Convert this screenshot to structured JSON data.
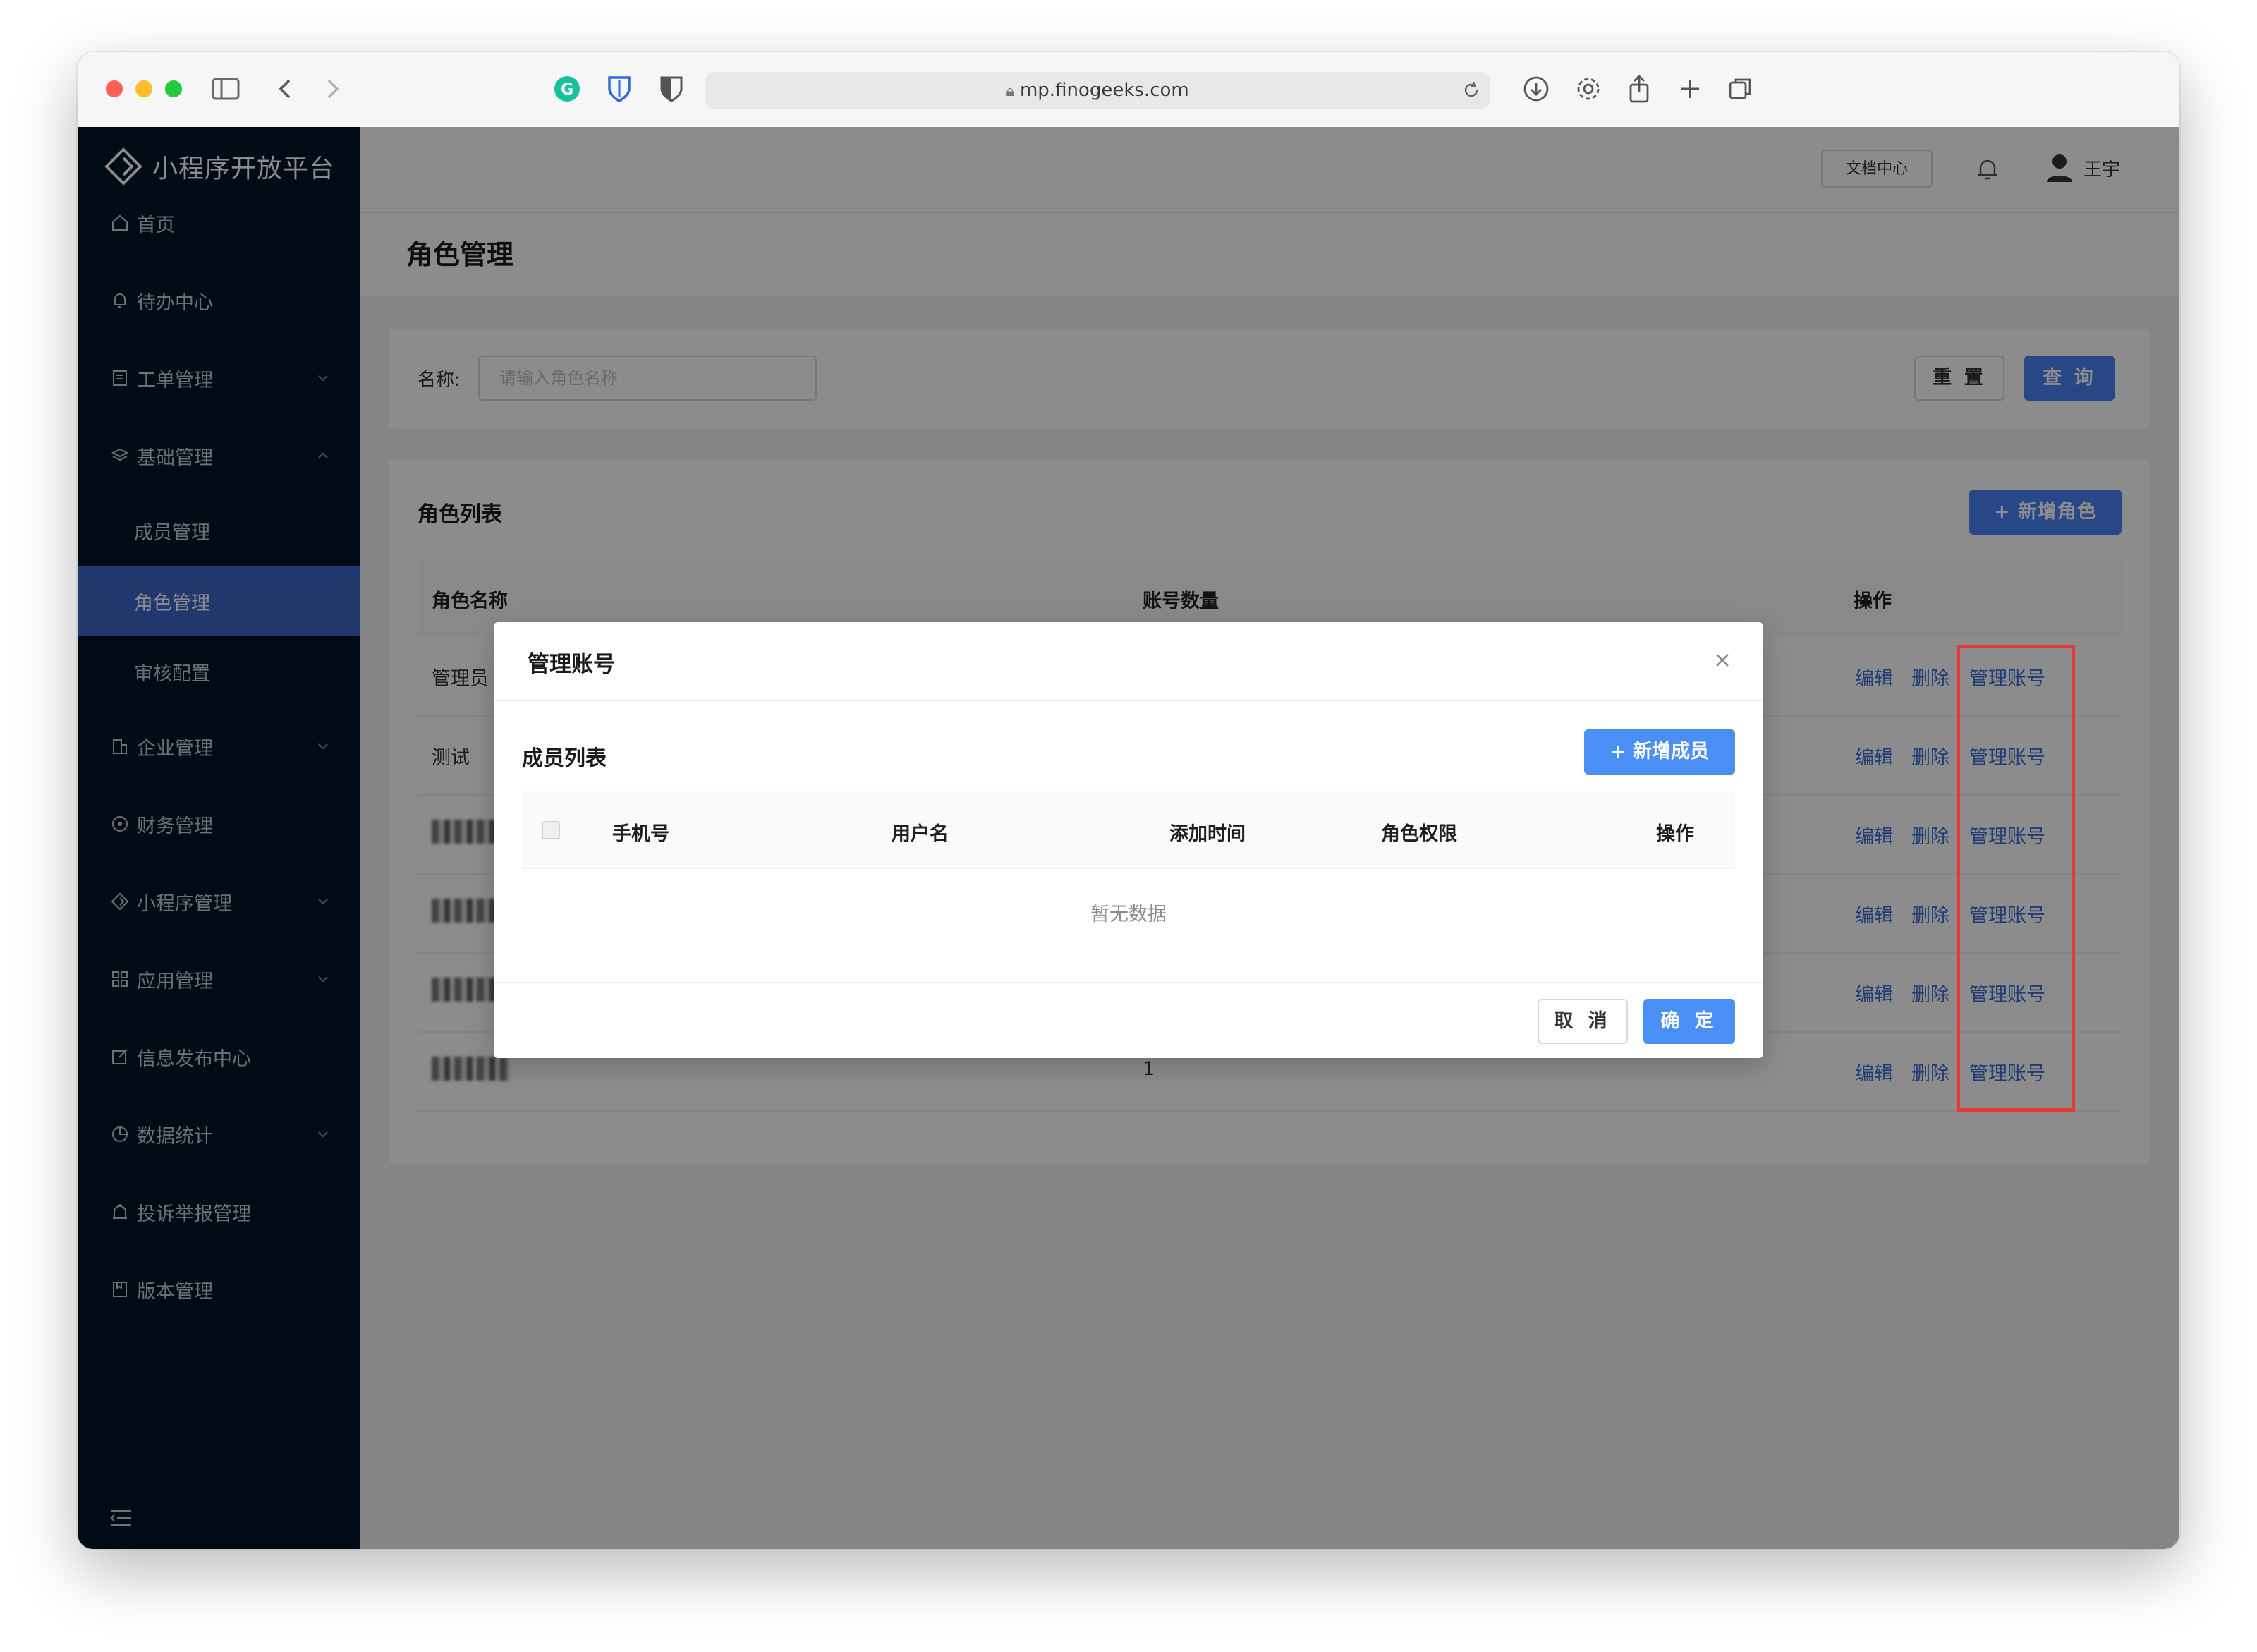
{
  "browser": {
    "url": "mp.finogeeks.com"
  },
  "sidebar": {
    "brand": "小程序开放平台",
    "items": [
      {
        "label": "首页",
        "icon": "home-icon",
        "has_arrow": false
      },
      {
        "label": "待办中心",
        "icon": "bell-icon",
        "has_arrow": false
      },
      {
        "label": "工单管理",
        "icon": "document-icon",
        "has_arrow": true
      },
      {
        "label": "基础管理",
        "icon": "layers-icon",
        "has_arrow": true,
        "expanded": true
      },
      {
        "label": "成员管理",
        "sub": true
      },
      {
        "label": "角色管理",
        "sub": true,
        "active": true
      },
      {
        "label": "审核配置",
        "sub": true
      },
      {
        "label": "企业管理",
        "icon": "building-icon",
        "has_arrow": true
      },
      {
        "label": "财务管理",
        "icon": "target-icon",
        "has_arrow": false
      },
      {
        "label": "小程序管理",
        "icon": "diamond-icon",
        "has_arrow": true
      },
      {
        "label": "应用管理",
        "icon": "grid-icon",
        "has_arrow": true
      },
      {
        "label": "信息发布中心",
        "icon": "edit-icon",
        "has_arrow": false
      },
      {
        "label": "数据统计",
        "icon": "pie-chart-icon",
        "has_arrow": true
      },
      {
        "label": "投诉举报管理",
        "icon": "alarm-icon",
        "has_arrow": false
      },
      {
        "label": "版本管理",
        "icon": "book-icon",
        "has_arrow": false
      }
    ]
  },
  "topbar": {
    "doc_center": "文档中心",
    "user_name": "王宇"
  },
  "page": {
    "title": "角色管理"
  },
  "filter": {
    "label": "名称:",
    "placeholder": "请输入角色名称",
    "reset": "重 置",
    "query": "查 询"
  },
  "list": {
    "title": "角色列表",
    "add_button": "+ 新增角色",
    "columns": [
      "角色名称",
      "账号数量",
      "操作"
    ],
    "rows": [
      {
        "name": "管理员",
        "count": ""
      },
      {
        "name": "测试",
        "count": ""
      },
      {
        "name": "",
        "count": ""
      },
      {
        "name": "",
        "count": ""
      },
      {
        "name": "",
        "count": ""
      },
      {
        "name": "",
        "count": "1"
      }
    ],
    "actions": {
      "edit": "编辑",
      "delete": "删除",
      "manage": "管理账号"
    }
  },
  "modal": {
    "title": "管理账号",
    "section_title": "成员列表",
    "add_member": "+ 新增成员",
    "columns": [
      "手机号",
      "用户名",
      "添加时间",
      "角色权限",
      "操作"
    ],
    "empty_text": "暂无数据",
    "cancel": "取 消",
    "confirm": "确 定"
  },
  "colors": {
    "sidebar_bg": "#001529",
    "active_item": "#3b67c8",
    "primary": "#4a82f6",
    "link": "#3b6fd8",
    "highlight_border": "#e53935"
  }
}
